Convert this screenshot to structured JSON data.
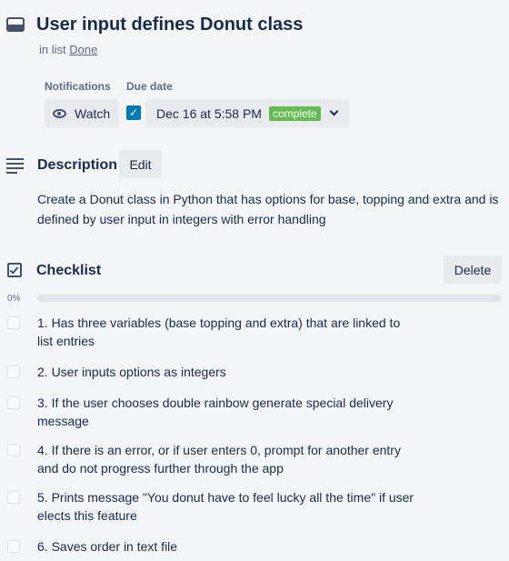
{
  "card": {
    "title": "User input defines Donut class",
    "in_list_prefix": "in list",
    "list_name": "Done"
  },
  "notifications": {
    "label": "Notifications",
    "watch_label": "Watch"
  },
  "due": {
    "label": "Due date",
    "value": "Dec 16 at 5:58 PM",
    "status": "complete",
    "checked": true,
    "status_color": "#61bd4f"
  },
  "description": {
    "heading": "Description",
    "edit_label": "Edit",
    "text": "Create a Donut class in Python that has options for base, topping and extra and is defined by user input in integers with error handling"
  },
  "checklist": {
    "heading": "Checklist",
    "delete_label": "Delete",
    "progress_label": "0%",
    "progress": 0,
    "items": [
      {
        "text": "1. Has three variables (base topping and extra) that are linked to list entries",
        "checked": false
      },
      {
        "text": "2. User inputs options as integers",
        "checked": false
      },
      {
        "text": "3. If the user chooses double rainbow generate special delivery message",
        "checked": false
      },
      {
        "text": "4. If there is an error, or if user enters 0, prompt for another entry and do not progress further through the app",
        "checked": false
      },
      {
        "text": "5. Prints message \"You donut have to feel lucky all the time\" if user elects this feature",
        "checked": false
      },
      {
        "text": "6. Saves order in text file",
        "checked": false
      }
    ]
  }
}
